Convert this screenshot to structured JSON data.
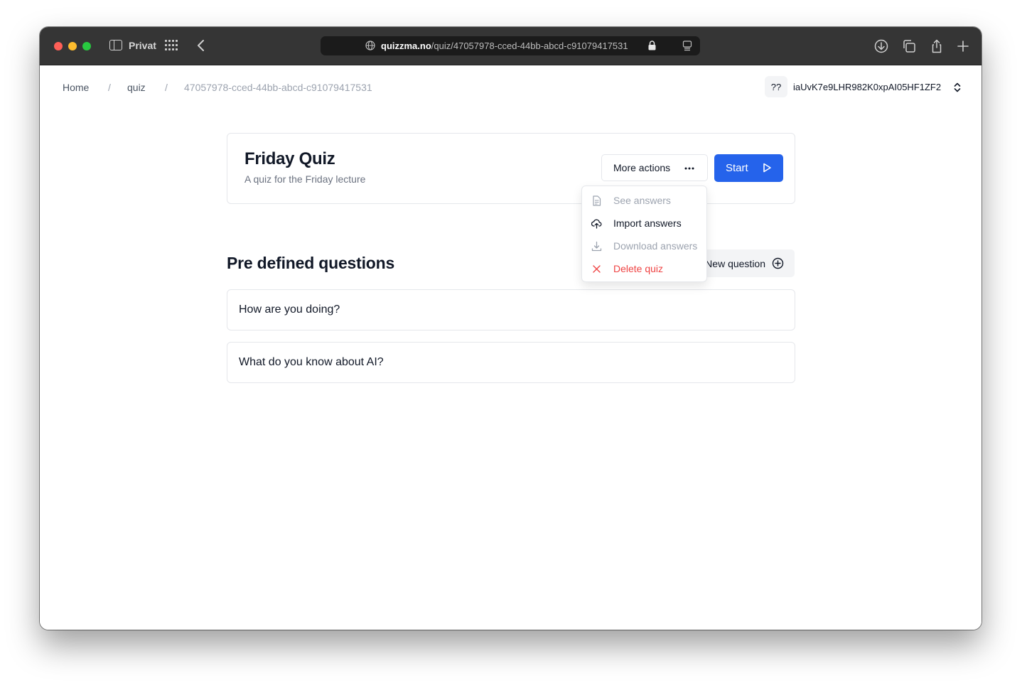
{
  "browser": {
    "tab_group": "Privat",
    "url_domain": "quizzma.no",
    "url_path": "/quiz/47057978-cced-44bb-abcd-c91079417531",
    "icons": [
      "sidebar-icon",
      "tab-overview-icon",
      "back-icon",
      "globe-icon",
      "lock-icon",
      "reader-icon",
      "download-icon",
      "tabs-icon",
      "share-icon",
      "new-tab-icon"
    ]
  },
  "breadcrumb": {
    "home": "Home",
    "sep1": "/",
    "quiz": "quiz",
    "sep2": "/",
    "current": "47057978-cced-44bb-abcd-c91079417531"
  },
  "user": {
    "badge": "??",
    "id": "iaUvK7e9LHR982K0xpAI05HF1ZF2"
  },
  "quiz": {
    "title": "Friday Quiz",
    "subtitle": "A quiz for the Friday lecture",
    "more_actions_label": "More actions",
    "start_label": "Start"
  },
  "menu": {
    "items": [
      {
        "label": "See answers",
        "state": "disabled",
        "icon": "document-icon"
      },
      {
        "label": "Import answers",
        "state": "normal",
        "icon": "cloud-upload-icon"
      },
      {
        "label": "Download answers",
        "state": "disabled",
        "icon": "download-icon"
      },
      {
        "label": "Delete quiz",
        "state": "danger",
        "icon": "close-icon"
      }
    ]
  },
  "questions_section": {
    "title": "Pre defined questions",
    "new_question_label": "New question",
    "questions": [
      {
        "text": "How are you doing?"
      },
      {
        "text": "What do you know about AI?"
      }
    ]
  },
  "colors": {
    "primary": "#2563eb",
    "danger": "#ef4444",
    "titlebar": "#353535"
  }
}
